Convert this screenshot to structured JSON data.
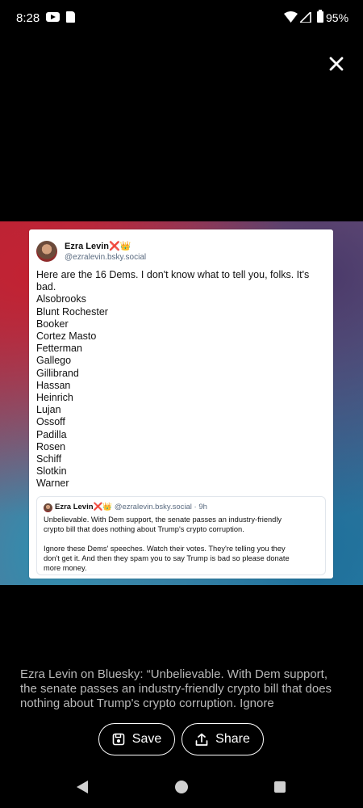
{
  "status_bar": {
    "time": "8:28",
    "battery": "95%"
  },
  "post": {
    "author_name": "Ezra Levin",
    "author_handle": "@ezralevin.bsky.social",
    "badges": "❌👑",
    "text_lines": [
      "Here are the 16 Dems. I don't know what to tell you, folks. It's",
      "bad.",
      "Alsobrooks",
      "Blunt Rochester",
      "Booker",
      "Cortez Masto",
      "Fetterman",
      "Gallego",
      "Gillibrand",
      "Hassan",
      "Heinrich",
      "Lujan",
      "Ossoff",
      "Padilla",
      "Rosen",
      "Schiff",
      "Slotkin",
      "Warner"
    ],
    "quote": {
      "author_name": "Ezra Levin",
      "badges": "❌👑",
      "handle_time": "@ezralevin.bsky.social · 9h",
      "text_lines": [
        "Unbelievable. With Dem support, the senate passes an industry-friendly",
        "crypto bill that does nothing about Trump's crypto corruption.",
        "",
        "Ignore these Dems' speeches. Watch their votes. They're telling you they",
        "don't get it. And then they spam you to say Trump is bad so please donate",
        "more money."
      ]
    }
  },
  "caption": "Ezra Levin on Bluesky: “Unbelievable. With Dem support, the senate passes an industry-friendly crypto bill that does nothing about Trump's crypto corruption. Ignore",
  "actions": {
    "save_label": "Save",
    "share_label": "Share"
  },
  "icons": {
    "close": "close-icon",
    "save": "save-icon",
    "share": "share-icon",
    "back": "back-icon",
    "home": "home-icon",
    "recents": "recents-icon"
  }
}
